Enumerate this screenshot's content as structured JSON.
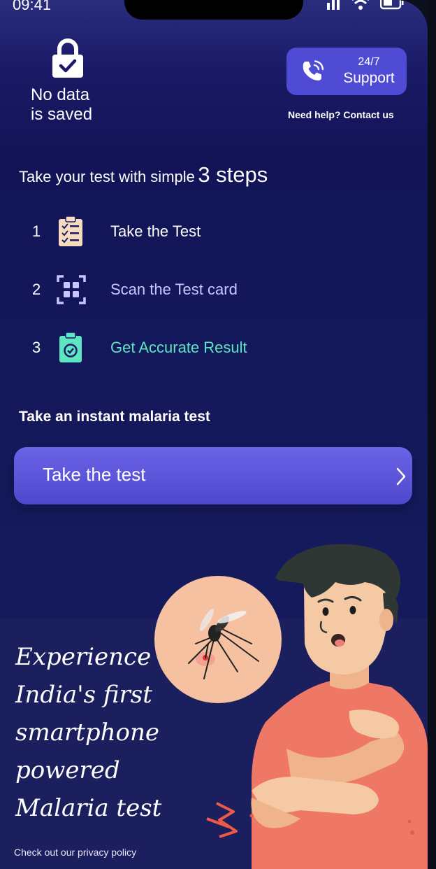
{
  "status_bar": {
    "time": "09:41"
  },
  "privacy": {
    "line1": "No data",
    "line2": "is saved"
  },
  "support": {
    "line1": "24/7",
    "line2": "Support",
    "help_link": "Need help? Contact us"
  },
  "steps": {
    "heading_prefix": "Take your test with simple",
    "heading_emphasis": "3 steps",
    "items": [
      {
        "number": "1",
        "label": "Take the Test",
        "icon": "clipboard-checklist-icon",
        "color": "#ffffff"
      },
      {
        "number": "2",
        "label": "Scan the Test card",
        "icon": "scan-qr-icon",
        "color": "#c9c6ff"
      },
      {
        "number": "3",
        "label": "Get Accurate Result",
        "icon": "clipboard-check-icon",
        "color": "#5ee6c2"
      }
    ]
  },
  "cta": {
    "prompt": "Take an instant malaria test",
    "button_label": "Take the test"
  },
  "promo": {
    "line1": "Experience",
    "line2": "India's first",
    "line3": "smartphone",
    "line4": "powered",
    "line5": "Malaria test"
  },
  "footer": {
    "privacy_link": "Check out our privacy policy"
  },
  "colors": {
    "accent": "#5a53d8",
    "background": "#13185a",
    "teal": "#5ee6c2",
    "lavender": "#c9c6ff"
  }
}
